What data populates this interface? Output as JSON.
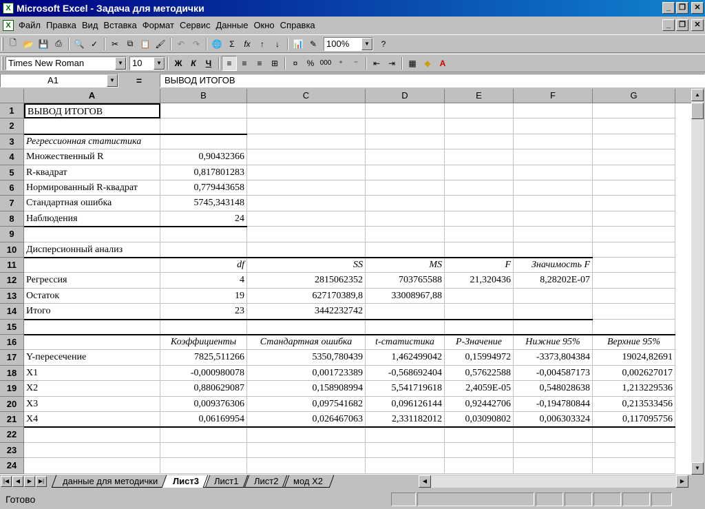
{
  "window": {
    "title": "Microsoft Excel - Задача для методички",
    "app_icon": "excel-icon"
  },
  "menu": [
    "Файл",
    "Правка",
    "Вид",
    "Вставка",
    "Формат",
    "Сервис",
    "Данные",
    "Окно",
    "Справка"
  ],
  "toolbar": {
    "zoom": "100%",
    "font": "Times New Roman",
    "size": "10",
    "bold": "Ж",
    "italic": "К",
    "underline": "Ч",
    "percent": "%",
    "thousands": "000"
  },
  "formula_bar": {
    "cell_ref": "A1",
    "eq": "=",
    "content": "ВЫВОД ИТОГОВ"
  },
  "columns": [
    "A",
    "B",
    "C",
    "D",
    "E",
    "F",
    "G"
  ],
  "rows": [
    "1",
    "2",
    "3",
    "4",
    "5",
    "6",
    "7",
    "8",
    "9",
    "10",
    "11",
    "12",
    "13",
    "14",
    "15",
    "16",
    "17",
    "18",
    "19",
    "20",
    "21",
    "22",
    "23",
    "24"
  ],
  "cells": {
    "r1": {
      "A": "ВЫВОД ИТОГОВ"
    },
    "r3": {
      "A": "Регрессионная статистика"
    },
    "r4": {
      "A": "Множественный R",
      "B": "0,90432366"
    },
    "r5": {
      "A": "R-квадрат",
      "B": "0,817801283"
    },
    "r6": {
      "A": "Нормированный R-квадрат",
      "B": "0,779443658"
    },
    "r7": {
      "A": "Стандартная ошибка",
      "B": "5745,343148"
    },
    "r8": {
      "A": "Наблюдения",
      "B": "24"
    },
    "r10": {
      "A": "Дисперсионный анализ"
    },
    "r11": {
      "B": "df",
      "C": "SS",
      "D": "MS",
      "E": "F",
      "F": "Значимость F"
    },
    "r12": {
      "A": "Регрессия",
      "B": "4",
      "C": "2815062352",
      "D": "703765588",
      "E": "21,320436",
      "F": "8,28202E-07"
    },
    "r13": {
      "A": "Остаток",
      "B": "19",
      "C": "627170389,8",
      "D": "33008967,88"
    },
    "r14": {
      "A": "Итого",
      "B": "23",
      "C": "3442232742"
    },
    "r16": {
      "B": "Коэффициенты",
      "C": "Стандартная ошибка",
      "D": "t-статистика",
      "E": "P-Значение",
      "F": "Нижние 95%",
      "G": "Верхние 95%"
    },
    "r17": {
      "A": "Y-пересечение",
      "B": "7825,511266",
      "C": "5350,780439",
      "D": "1,462499042",
      "E": "0,15994972",
      "F": "-3373,804384",
      "G": "19024,82691"
    },
    "r18": {
      "A": "X1",
      "B": "-0,000980078",
      "C": "0,001723389",
      "D": "-0,568692404",
      "E": "0,57622588",
      "F": "-0,004587173",
      "G": "0,002627017"
    },
    "r19": {
      "A": "X2",
      "B": "0,880629087",
      "C": "0,158908994",
      "D": "5,541719618",
      "E": "2,4059E-05",
      "F": "0,548028638",
      "G": "1,213229536"
    },
    "r20": {
      "A": "X3",
      "B": "0,009376306",
      "C": "0,097541682",
      "D": "0,096126144",
      "E": "0,92442706",
      "F": "-0,194780844",
      "G": "0,213533456"
    },
    "r21": {
      "A": "X4",
      "B": "0,06169954",
      "C": "0,026467063",
      "D": "2,331182012",
      "E": "0,03090802",
      "F": "0,006303324",
      "G": "0,117095756"
    }
  },
  "sheet_tabs": [
    "данные для методички",
    "Лист3",
    "Лист1",
    "Лист2",
    "мод X2"
  ],
  "active_tab": "Лист3",
  "status": "Готово"
}
